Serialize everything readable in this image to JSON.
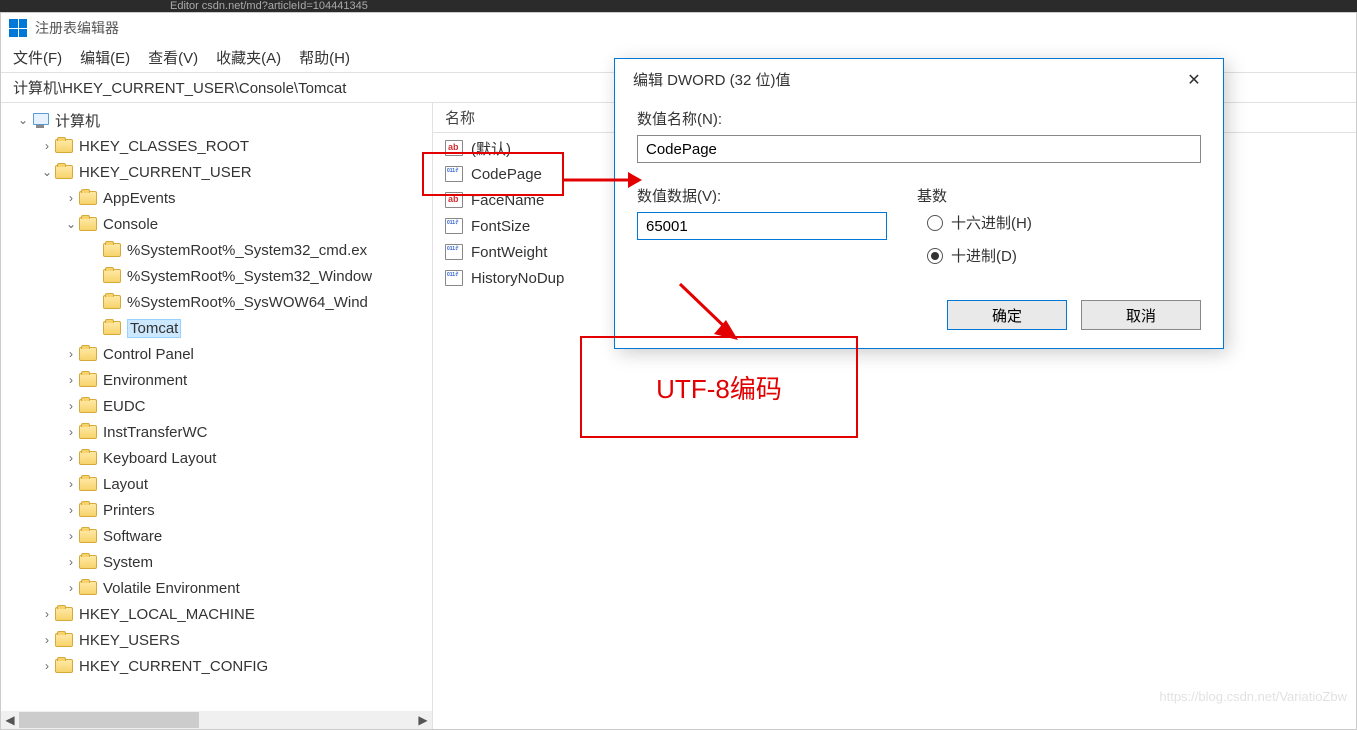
{
  "top_snippet": "Editor csdn.net/md?articleId=104441345",
  "window_title": "注册表编辑器",
  "menu": [
    "文件(F)",
    "编辑(E)",
    "查看(V)",
    "收藏夹(A)",
    "帮助(H)"
  ],
  "address": "计算机\\HKEY_CURRENT_USER\\Console\\Tomcat",
  "tree": [
    {
      "depth": 0,
      "chev": "down",
      "icon": "pc",
      "label": "计算机"
    },
    {
      "depth": 1,
      "chev": "right",
      "icon": "folder",
      "label": "HKEY_CLASSES_ROOT"
    },
    {
      "depth": 1,
      "chev": "down",
      "icon": "folder",
      "label": "HKEY_CURRENT_USER"
    },
    {
      "depth": 2,
      "chev": "right",
      "icon": "folder",
      "label": "AppEvents"
    },
    {
      "depth": 2,
      "chev": "down",
      "icon": "folder",
      "label": "Console"
    },
    {
      "depth": 3,
      "chev": "none",
      "icon": "folder",
      "label": "%SystemRoot%_System32_cmd.ex"
    },
    {
      "depth": 3,
      "chev": "none",
      "icon": "folder",
      "label": "%SystemRoot%_System32_Window"
    },
    {
      "depth": 3,
      "chev": "none",
      "icon": "folder",
      "label": "%SystemRoot%_SysWOW64_Wind"
    },
    {
      "depth": 3,
      "chev": "none",
      "icon": "folder",
      "label": "Tomcat",
      "selected": true
    },
    {
      "depth": 2,
      "chev": "right",
      "icon": "folder",
      "label": "Control Panel"
    },
    {
      "depth": 2,
      "chev": "right",
      "icon": "folder",
      "label": "Environment"
    },
    {
      "depth": 2,
      "chev": "right",
      "icon": "folder",
      "label": "EUDC"
    },
    {
      "depth": 2,
      "chev": "right",
      "icon": "folder",
      "label": "InstTransferWC"
    },
    {
      "depth": 2,
      "chev": "right",
      "icon": "folder",
      "label": "Keyboard Layout"
    },
    {
      "depth": 2,
      "chev": "right",
      "icon": "folder",
      "label": "Layout"
    },
    {
      "depth": 2,
      "chev": "right",
      "icon": "folder",
      "label": "Printers"
    },
    {
      "depth": 2,
      "chev": "right",
      "icon": "folder",
      "label": "Software"
    },
    {
      "depth": 2,
      "chev": "right",
      "icon": "folder",
      "label": "System"
    },
    {
      "depth": 2,
      "chev": "right",
      "icon": "folder",
      "label": "Volatile Environment"
    },
    {
      "depth": 1,
      "chev": "right",
      "icon": "folder",
      "label": "HKEY_LOCAL_MACHINE"
    },
    {
      "depth": 1,
      "chev": "right",
      "icon": "folder",
      "label": "HKEY_USERS"
    },
    {
      "depth": 1,
      "chev": "right",
      "icon": "folder",
      "label": "HKEY_CURRENT_CONFIG"
    }
  ],
  "list_header": "名称",
  "list_items": [
    {
      "icon": "str",
      "label": "(默认)"
    },
    {
      "icon": "bin",
      "label": "CodePage"
    },
    {
      "icon": "str",
      "label": "FaceName"
    },
    {
      "icon": "bin",
      "label": "FontSize"
    },
    {
      "icon": "bin",
      "label": "FontWeight"
    },
    {
      "icon": "bin",
      "label": "HistoryNoDup"
    }
  ],
  "dialog": {
    "title": "编辑 DWORD (32 位)值",
    "name_label": "数值名称(N):",
    "name_value": "CodePage",
    "data_label": "数值数据(V):",
    "data_value": "65001",
    "base_label": "基数",
    "radio_hex": "十六进制(H)",
    "radio_dec": "十进制(D)",
    "ok": "确定",
    "cancel": "取消"
  },
  "annotation": "UTF-8编码",
  "watermark": "https://blog.csdn.net/VariatioZbw"
}
